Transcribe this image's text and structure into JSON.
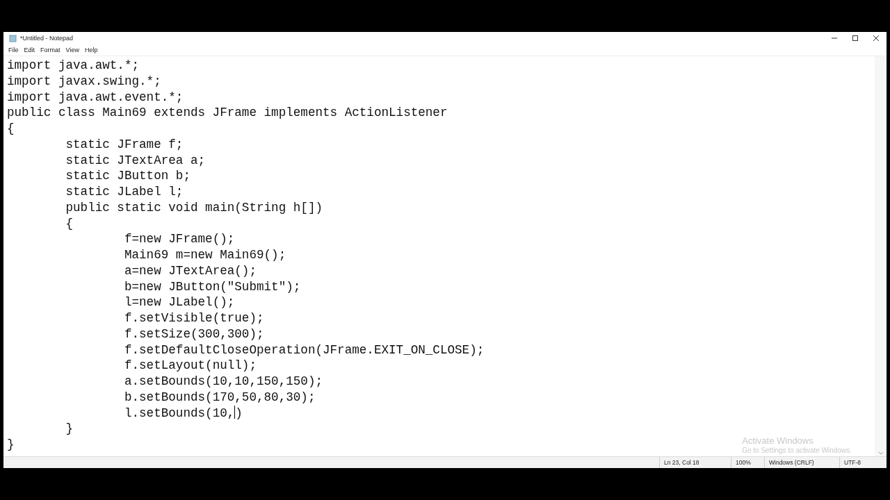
{
  "window": {
    "title": "*Untitled - Notepad"
  },
  "menu": [
    "File",
    "Edit",
    "Format",
    "View",
    "Help"
  ],
  "editor": {
    "lines": [
      {
        "kind": "text",
        "text": "import java.awt.*;"
      },
      {
        "kind": "text",
        "text": "import javax.swing.*;"
      },
      {
        "kind": "text",
        "text": "import java.awt.event.*;"
      },
      {
        "kind": "text",
        "text": "public class Main69 extends JFrame implements ActionListener"
      },
      {
        "kind": "text",
        "text": "{"
      },
      {
        "kind": "text",
        "text": "\tstatic JFrame f;"
      },
      {
        "kind": "text",
        "text": "\tstatic JTextArea a;"
      },
      {
        "kind": "text",
        "text": "\tstatic JButton b;"
      },
      {
        "kind": "text",
        "text": "\tstatic JLabel l;"
      },
      {
        "kind": "text",
        "text": "\tpublic static void main(String h[])"
      },
      {
        "kind": "text",
        "text": "\t{"
      },
      {
        "kind": "text",
        "text": "\t\tf=new JFrame();"
      },
      {
        "kind": "text",
        "text": "\t\tMain69 m=new Main69();"
      },
      {
        "kind": "text",
        "text": "\t\ta=new JTextArea();"
      },
      {
        "kind": "text",
        "text": "\t\tb=new JButton(\"Submit\");"
      },
      {
        "kind": "text",
        "text": "\t\tl=new JLabel();"
      },
      {
        "kind": "text",
        "text": "\t\tf.setVisible(true);"
      },
      {
        "kind": "text",
        "text": "\t\tf.setSize(300,300);"
      },
      {
        "kind": "text",
        "text": "\t\tf.setDefaultCloseOperation(JFrame.EXIT_ON_CLOSE);"
      },
      {
        "kind": "text",
        "text": "\t\tf.setLayout(null);"
      },
      {
        "kind": "text",
        "text": "\t\ta.setBounds(10,10,150,150);"
      },
      {
        "kind": "text",
        "text": "\t\tb.setBounds(170,50,80,30);"
      },
      {
        "kind": "caret",
        "before": "\t\tl.setBounds(10,",
        "after": ")"
      },
      {
        "kind": "text",
        "text": "\t}"
      },
      {
        "kind": "text",
        "text": "}"
      }
    ]
  },
  "activation": {
    "title": "Activate Windows",
    "subtitle": "Go to Settings to activate Windows."
  },
  "status_bar": {
    "position": "Ln 23, Col 18",
    "zoom": "100%",
    "line_ending": "Windows (CRLF)",
    "encoding": "UTF-8"
  }
}
